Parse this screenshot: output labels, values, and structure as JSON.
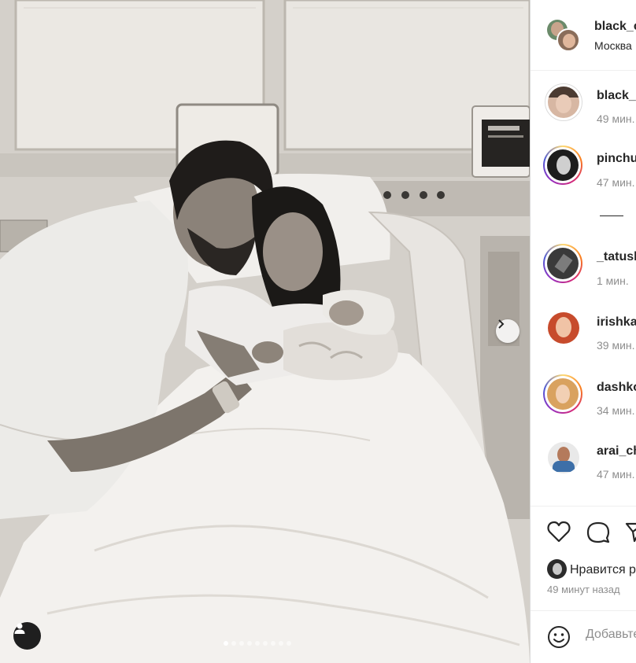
{
  "post": {
    "author": "black_c",
    "location": "Москва",
    "carousel": {
      "slide_count": 9,
      "active_index": 0
    }
  },
  "comments": [
    {
      "user": "black_",
      "time": "49 мин.",
      "ring": "grey"
    },
    {
      "user": "pinchu",
      "time": "47 мин.",
      "ring": "story"
    },
    {
      "user": "_tatush",
      "time": "1 мин.",
      "ring": "story"
    },
    {
      "user": "irishka",
      "time": "39 мин.",
      "ring": "none"
    },
    {
      "user": "dashko",
      "time": "34 мин.",
      "ring": "story"
    },
    {
      "user": "arai_ch",
      "time": "47 мин.",
      "ring": "none"
    }
  ],
  "footer": {
    "likes_text": "Нравится р",
    "post_time": "49 минут назад",
    "comment_placeholder": "Добавьте"
  },
  "icons": {
    "like": "heart-icon",
    "comment": "comment-icon",
    "share": "paper-plane-icon",
    "emoji": "smile-icon",
    "next": "chevron-right-icon",
    "tag": "user-tag-icon"
  },
  "colors": {
    "text": "#262626",
    "muted": "#8e8e8e",
    "border": "#dbdbdb"
  }
}
